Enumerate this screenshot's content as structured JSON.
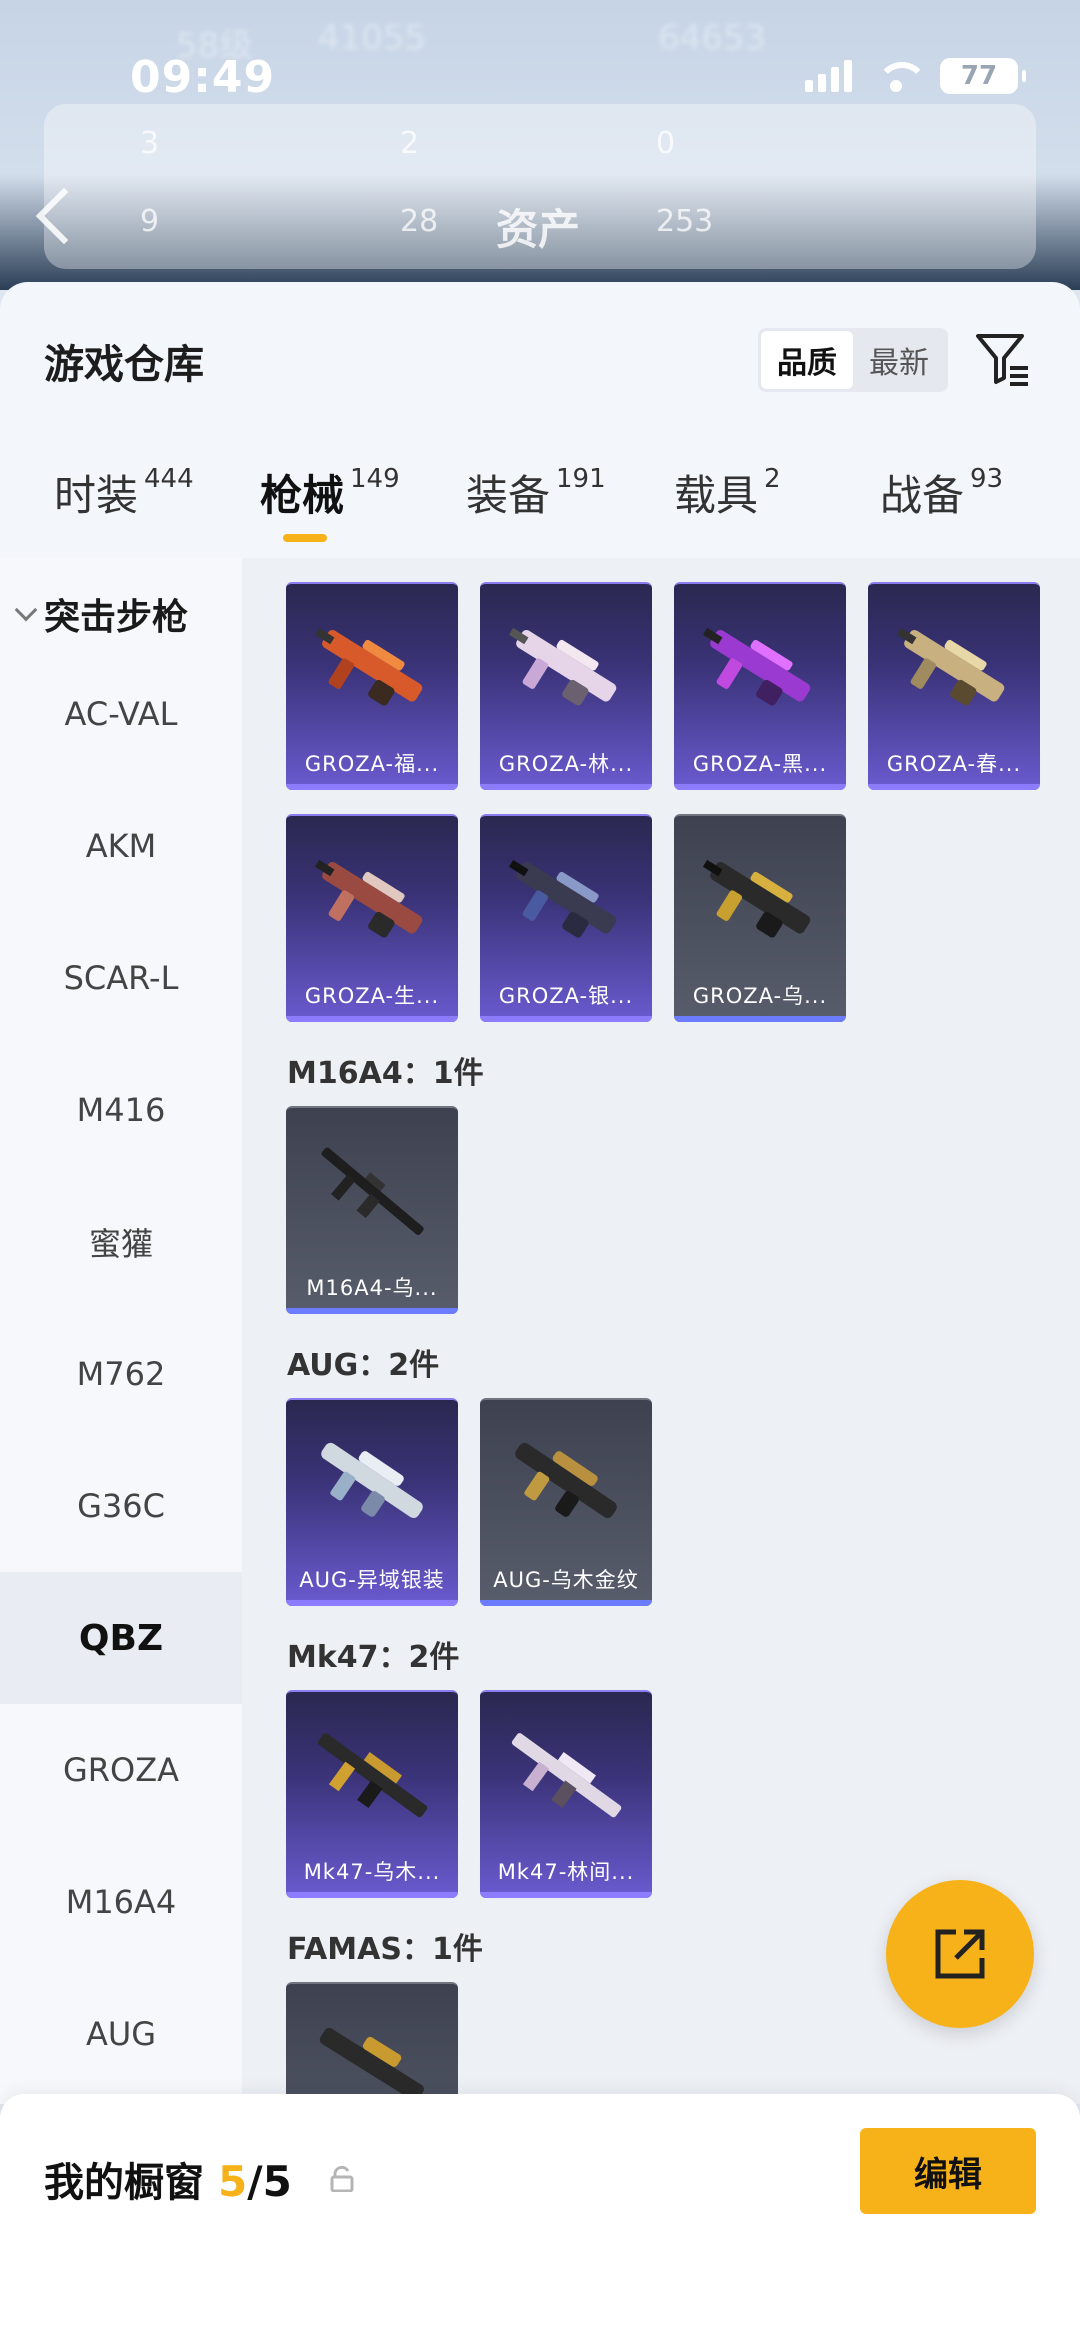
{
  "status": {
    "time": "09:49",
    "battery": "77"
  },
  "bg": {
    "level": "58级",
    "stat1": "41055",
    "stat2": "64653",
    "row1": [
      "3",
      "2",
      "0"
    ],
    "row2": [
      "9",
      "28",
      "253"
    ],
    "title": "资产"
  },
  "warehouse": {
    "title": "游戏仓库",
    "sort": [
      "品质",
      "最新"
    ]
  },
  "tabs": [
    {
      "label": "时装",
      "count": "444"
    },
    {
      "label": "枪械",
      "count": "149"
    },
    {
      "label": "装备",
      "count": "191"
    },
    {
      "label": "载具",
      "count": "2"
    },
    {
      "label": "战备",
      "count": "93"
    }
  ],
  "sidebar": {
    "header": "突击步枪",
    "items": [
      "AC-VAL",
      "AKM",
      "SCAR-L",
      "M416",
      "蜜獾",
      "M762",
      "G36C",
      "QBZ",
      "GROZA",
      "M16A4",
      "AUG"
    ],
    "active": "QBZ"
  },
  "groups": {
    "m16a4": "M16A4：1件",
    "aug": "AUG：2件",
    "mk47": "Mk47：2件",
    "famas": "FAMAS：1件"
  },
  "skins": {
    "groza": [
      "GROZA-福...",
      "GROZA-林...",
      "GROZA-黑...",
      "GROZA-春...",
      "GROZA-生...",
      "GROZA-银...",
      "GROZA-乌..."
    ],
    "m16a4": [
      "M16A4-乌..."
    ],
    "aug": [
      "AUG-异域银装",
      "AUG-乌木金纹"
    ],
    "mk47": [
      "Mk47-乌木...",
      "Mk47-林间..."
    ]
  },
  "colors": {
    "accent": "#f6b218",
    "rare": "#8e7cff"
  },
  "showcase": {
    "title": "我的橱窗",
    "used": "5",
    "total": "/5",
    "edit": "编辑"
  }
}
